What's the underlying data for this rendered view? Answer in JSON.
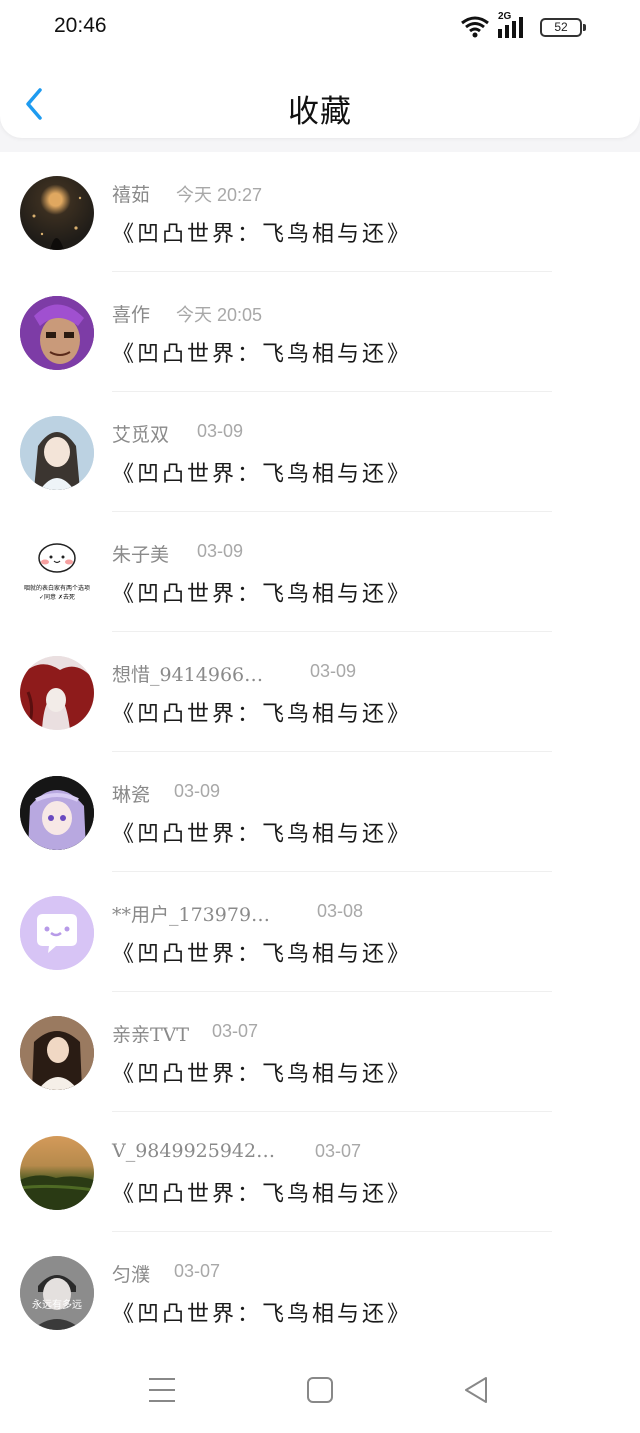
{
  "status_bar": {
    "time": "20:46",
    "network": "2G",
    "battery": "52"
  },
  "header": {
    "title": "收藏"
  },
  "items": [
    {
      "name": "禧茹",
      "time": "今天 20:27",
      "work": "《凹凸世界：飞鸟相与还》",
      "avatar_color": "#2a2418"
    },
    {
      "name": "喜作",
      "time": "今天 20:05",
      "work": "《凹凸世界：飞鸟相与还》",
      "avatar_color": "#7a3a9a"
    },
    {
      "name": "艾觅双",
      "time": "03-09",
      "work": "《凹凸世界：飞鸟相与还》",
      "avatar_color": "#9bb7cf"
    },
    {
      "name": "朱子美",
      "time": "03-09",
      "work": "《凹凸世界：飞鸟相与还》",
      "avatar_color": "#ffffff"
    },
    {
      "name": "想惜_9414966…",
      "time": "03-09",
      "work": "《凹凸世界：飞鸟相与还》",
      "avatar_color": "#8b1a1a"
    },
    {
      "name": "琳瓷",
      "time": "03-09",
      "work": "《凹凸世界：飞鸟相与还》",
      "avatar_color": "#b7a6d8"
    },
    {
      "name": "**用户_173979…",
      "time": "03-08",
      "work": "《凹凸世界：飞鸟相与还》",
      "avatar_color": "#d7c4f5"
    },
    {
      "name": "亲亲TVT",
      "time": "03-07",
      "work": "《凹凸世界：飞鸟相与还》",
      "avatar_color": "#6a4a36"
    },
    {
      "name": "V_9849925942…",
      "time": "03-07",
      "work": "《凹凸世界：飞鸟相与还》",
      "avatar_color": "#6b5a2a"
    },
    {
      "name": "匀濮",
      "time": "03-07",
      "work": "《凹凸世界：飞鸟相与还》",
      "avatar_color": "#8e8e8e"
    }
  ],
  "avatar_captions": {
    "item4": "咽就的表白家有两个选项 ✓同意 ✗去死",
    "item10": "永远有多远"
  },
  "colors": {
    "accent": "#1e9bf0",
    "chat_bubble": "#d7c4f5"
  }
}
